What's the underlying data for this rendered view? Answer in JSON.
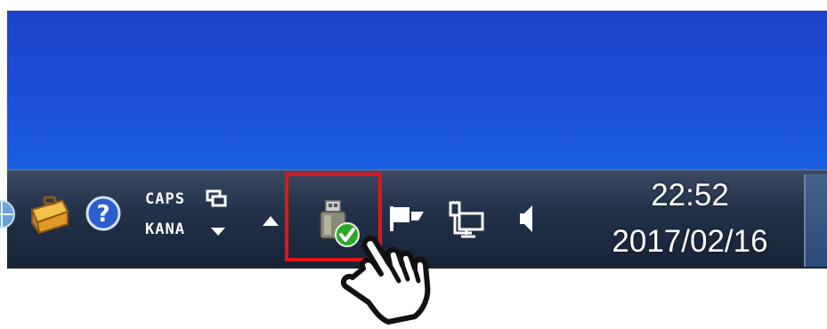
{
  "taskbar": {
    "ime": {
      "line1": "CAPS",
      "line2": "KANA"
    },
    "clock": {
      "time": "22:52",
      "date": "2017/02/16"
    }
  },
  "icons": [
    "network-globe-icon",
    "toolbox-icon",
    "help-icon",
    "ime-mode-icon",
    "dropdown-arrow-icon",
    "show-hidden-icons-arrow",
    "usb-safely-remove-icon",
    "action-center-flag-icon",
    "network-icon",
    "volume-icon",
    "pointing-hand-cursor-icon"
  ],
  "colors": {
    "desktop_blue": "#1d4fd8",
    "taskbar_dark": "#23324a",
    "highlight_red": "#e6121b",
    "check_green": "#2ea82a"
  }
}
